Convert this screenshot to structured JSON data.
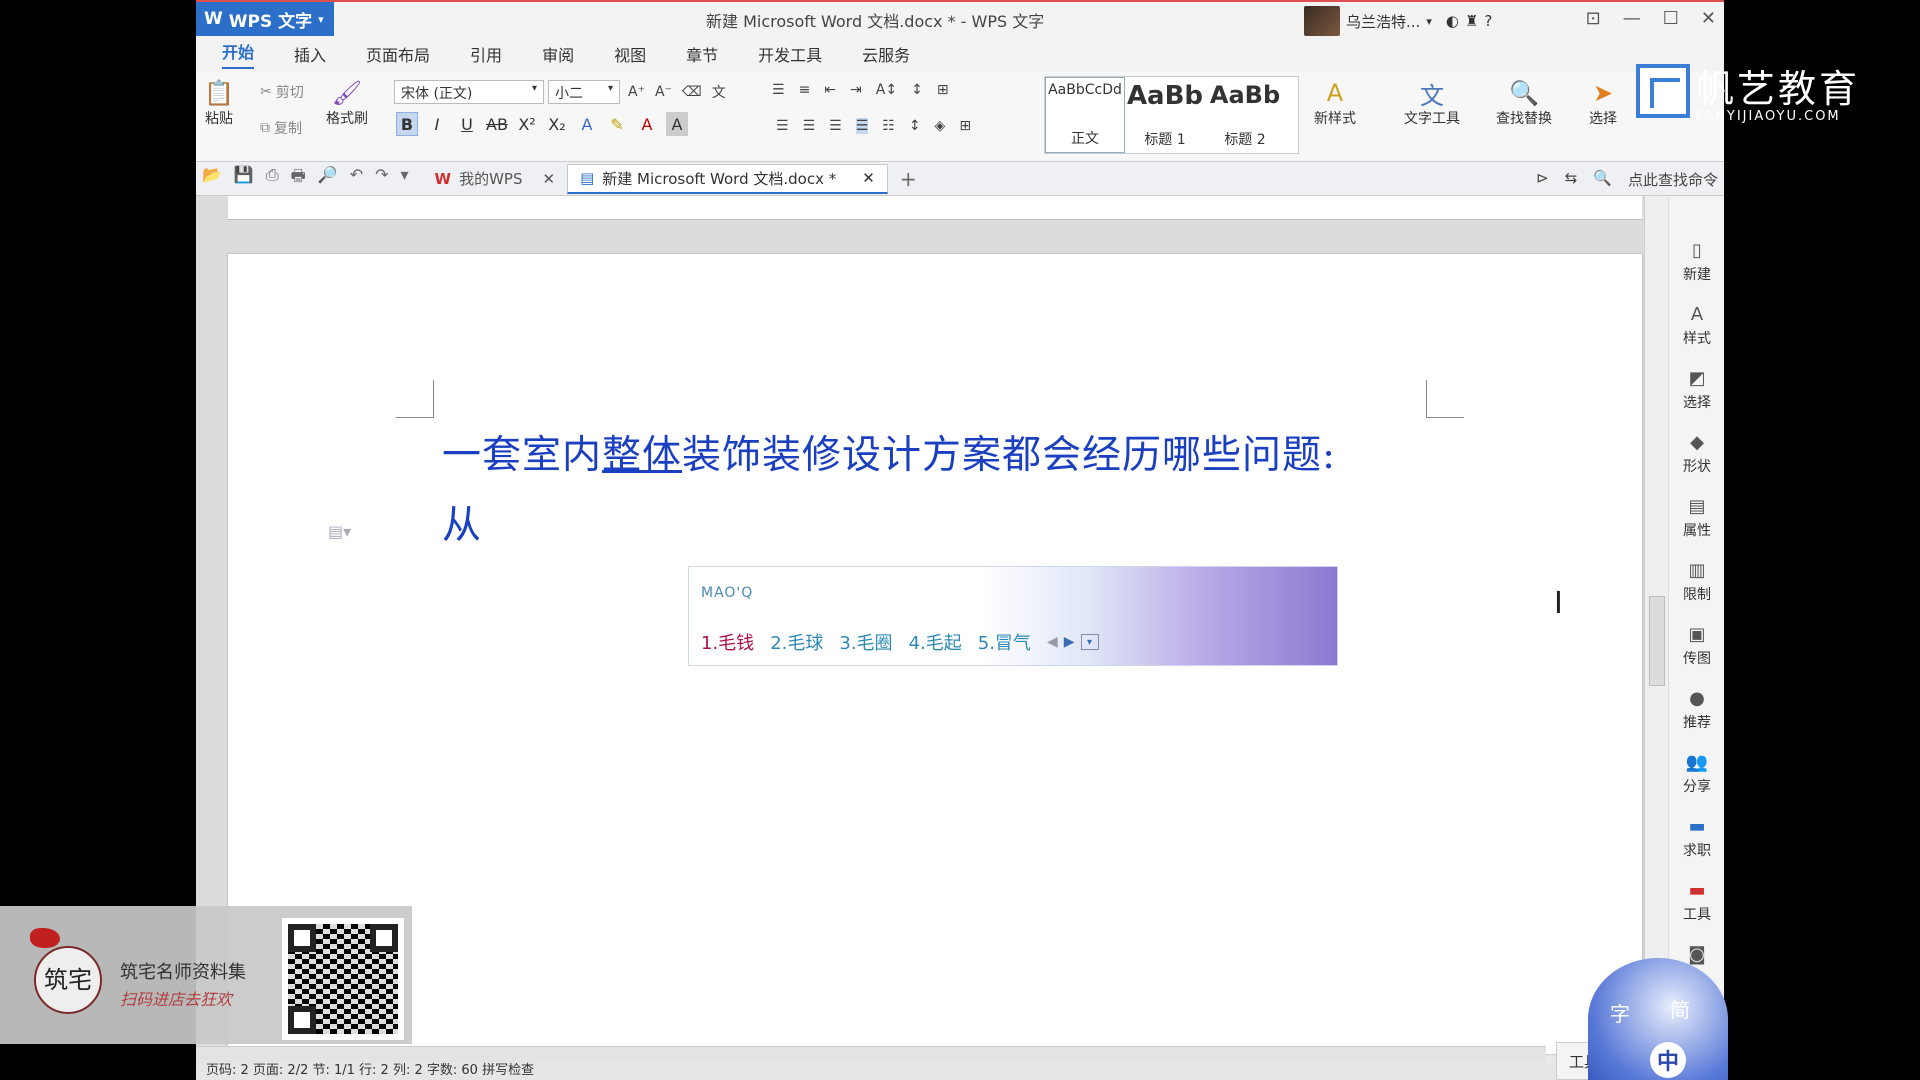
{
  "app": {
    "menu_label": "WPS 文字",
    "window_title": "新建 Microsoft Word 文档.docx * - WPS 文字",
    "user_name": "乌兰浩特..."
  },
  "ribbon_tabs": [
    "开始",
    "插入",
    "页面布局",
    "引用",
    "审阅",
    "视图",
    "章节",
    "开发工具",
    "云服务"
  ],
  "ribbon": {
    "paste": "粘贴",
    "cut": "剪切",
    "copy": "复制",
    "format_painter": "格式刷",
    "font_name": "宋体 (正文)",
    "font_size": "小二",
    "styles": [
      {
        "preview": "AaBbCcDd",
        "label": "正文"
      },
      {
        "preview": "AaBb",
        "label": "标题 1"
      },
      {
        "preview": "AaBb",
        "label": "标题 2"
      }
    ],
    "new_style": "新样式",
    "text_tools": "文字工具",
    "find_replace": "查找替换",
    "select": "选择"
  },
  "quickbar": {
    "tabs": [
      {
        "label": "我的WPS",
        "active": false
      },
      {
        "label": "新建 Microsoft Word 文档.docx *",
        "active": true
      }
    ],
    "search_command": "点此查找命令"
  },
  "document": {
    "heading_part1": "一套室内",
    "heading_underlined": "整体",
    "heading_part2": "装饰装修设计方案都会经历哪些问题:",
    "line2": "从"
  },
  "ime": {
    "composition": "MAO'Q",
    "candidates": [
      "1.毛钱",
      "2.毛球",
      "3.毛圈",
      "4.毛起",
      "5.冒气"
    ]
  },
  "sidebar_items": [
    "新建",
    "样式",
    "选择",
    "形状",
    "属性",
    "限制",
    "传图",
    "推荐",
    "分享",
    "求职",
    "工具"
  ],
  "status_bar": "页码: 2  页面: 2/2  节: 1/1  行: 2  列: 2  字数: 60  拼写检查",
  "watermark": {
    "cn": "帆艺教育",
    "en": "FANYIJIAOYU.COM"
  },
  "promo": {
    "logo_text": "筑宅",
    "name": "筑宅名师资料集",
    "sub": "扫码进店去狂欢"
  },
  "ime_badge": {
    "chars": [
      "字",
      "简",
      "中"
    ]
  },
  "tool_button": "工具"
}
